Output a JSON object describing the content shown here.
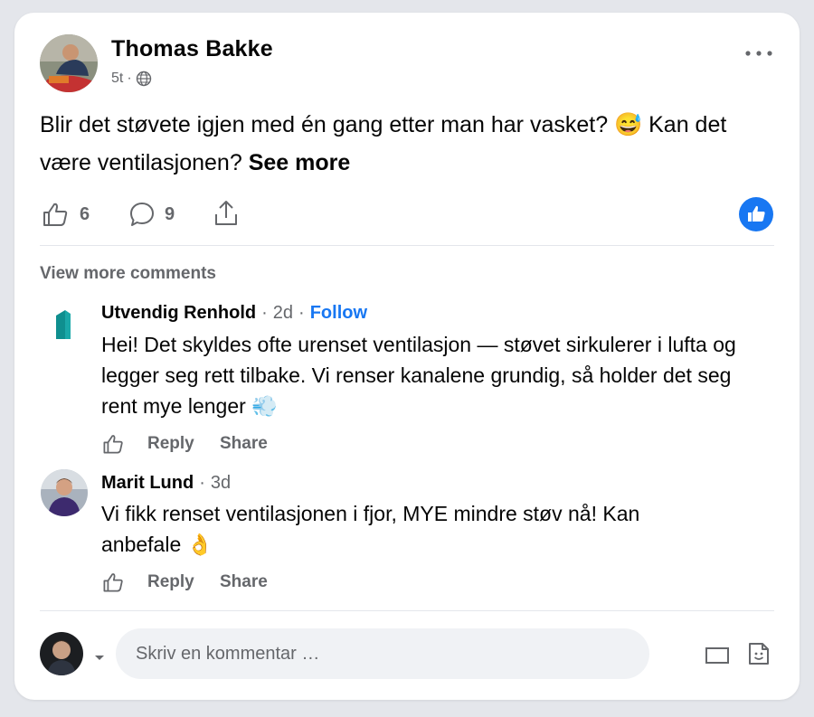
{
  "post": {
    "author": "Thomas Bakke",
    "time": "5t",
    "separator": "·",
    "text": "Blir det støvete igjen med én gang etter man har vasket? 😅 Kan det være ventilasjonen?",
    "see_more": "See more",
    "likes": "6",
    "comments": "9"
  },
  "comments_section": {
    "view_more": "View more comments",
    "comments": [
      {
        "author": "Utvendig Renhold",
        "time": "2d",
        "follow": "Follow",
        "text": "Hei! Det skyldes ofte urenset ventilasjon — støvet sirkulerer i lufta og legger seg rett tilbake. Vi renser kanalene grundig, så holder det seg rent mye lenger 💨",
        "reply": "Reply",
        "share": "Share"
      },
      {
        "author": "Marit Lund",
        "time": "3d",
        "text": "Vi fikk renset ventilasjonen i fjor, MYE mindre støv nå! Kan anbefale 👌",
        "reply": "Reply",
        "share": "Share"
      }
    ]
  },
  "composer": {
    "placeholder": "Skriv en kommentar …"
  },
  "colors": {
    "accent": "#1877f2",
    "secondary_text": "#65676b",
    "brand_teal": "#0f8f8f"
  },
  "icons": [
    "more-options-icon",
    "globe-icon",
    "like-icon",
    "comment-icon",
    "share-icon",
    "like-badge-icon",
    "caret-down-icon",
    "sticker-icon",
    "photo-icon"
  ]
}
